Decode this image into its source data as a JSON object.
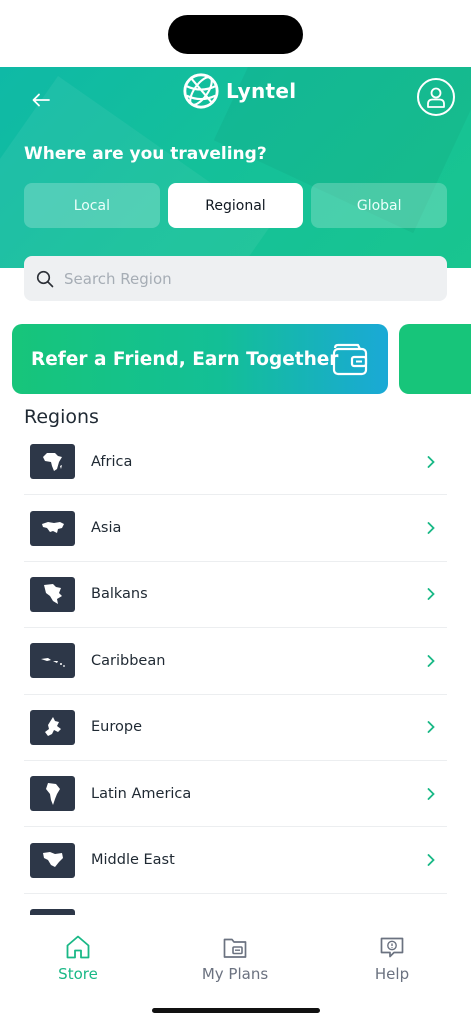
{
  "app": {
    "name": "Lyntel"
  },
  "header": {
    "question": "Where are you traveling?",
    "tabs": [
      {
        "label": "Local",
        "active": false
      },
      {
        "label": "Regional",
        "active": true
      },
      {
        "label": "Global",
        "active": false
      }
    ]
  },
  "search": {
    "placeholder": "Search Region",
    "value": ""
  },
  "banner": {
    "text": "Refer a Friend, Earn Together"
  },
  "regions": {
    "title": "Regions",
    "items": [
      {
        "label": "Africa",
        "icon": "africa-map-icon"
      },
      {
        "label": "Asia",
        "icon": "asia-map-icon"
      },
      {
        "label": "Balkans",
        "icon": "balkans-map-icon"
      },
      {
        "label": "Caribbean",
        "icon": "caribbean-map-icon"
      },
      {
        "label": "Europe",
        "icon": "europe-map-icon"
      },
      {
        "label": "Latin America",
        "icon": "latin-america-map-icon"
      },
      {
        "label": "Middle East",
        "icon": "middle-east-map-icon"
      }
    ]
  },
  "nav": {
    "items": [
      {
        "label": "Store",
        "icon": "home-icon",
        "active": true
      },
      {
        "label": "My Plans",
        "icon": "plans-folder-icon",
        "active": false
      },
      {
        "label": "Help",
        "icon": "help-chat-icon",
        "active": false
      }
    ]
  },
  "colors": {
    "accent": "#19b886",
    "header_start": "#0fb9a6",
    "header_end": "#19c58f",
    "map_tile": "#2d3748"
  }
}
